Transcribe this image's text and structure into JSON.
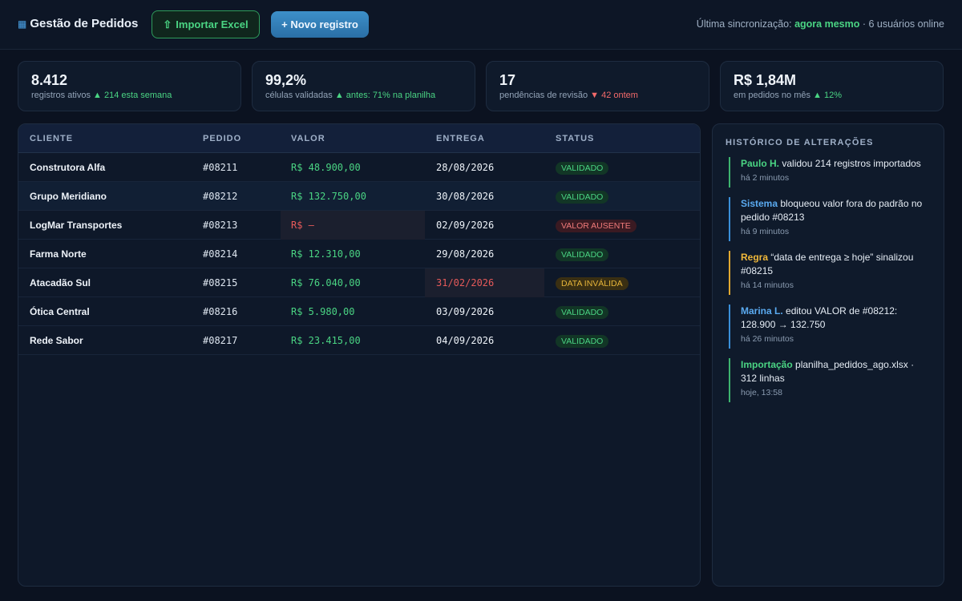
{
  "header": {
    "brand_icon": "▦",
    "title": "Gestão de Pedidos",
    "import_icon": "⇧",
    "import_label": "Importar Excel",
    "new_label": "+ Novo registro",
    "sync_prefix": "Última sincronização:",
    "sync_time": "agora mesmo",
    "sync_suffix": "· 6 usuários online"
  },
  "kpis": [
    {
      "value": "8.412",
      "label": "registros ativos",
      "trend_icon": "▲",
      "trend": "214 esta semana",
      "trend_dir": "up"
    },
    {
      "value": "99,2%",
      "label": "células validadas",
      "trend_icon": "▲",
      "trend": "antes: 71% na planilha",
      "trend_dir": "up"
    },
    {
      "value": "17",
      "label": "pendências de revisão",
      "trend_icon": "▼",
      "trend": "42 ontem",
      "trend_dir": "down"
    },
    {
      "value": "R$ 1,84M",
      "label": "em pedidos no mês",
      "trend_icon": "▲",
      "trend": "12%",
      "trend_dir": "up"
    }
  ],
  "table": {
    "columns": [
      "CLIENTE",
      "PEDIDO",
      "VALOR",
      "ENTREGA",
      "STATUS"
    ],
    "rows": [
      {
        "client": "Construtora Alfa",
        "order": "#08211",
        "value": "R$ 48.900,00",
        "date": "28/08/2026",
        "status": "VALIDADO"
      },
      {
        "client": "Grupo Meridiano",
        "order": "#08212",
        "value": "R$ 132.750,00",
        "date": "30/08/2026",
        "status": "VALIDADO"
      },
      {
        "client": "LogMar Transportes",
        "order": "#08213",
        "value": "R$ —",
        "date": "02/09/2026",
        "status": "VALOR AUSENTE"
      },
      {
        "client": "Farma Norte",
        "order": "#08214",
        "value": "R$ 12.310,00",
        "date": "29/08/2026",
        "status": "VALIDADO"
      },
      {
        "client": "Atacadão Sul",
        "order": "#08215",
        "value": "R$ 76.040,00",
        "date": "31/02/2026",
        "status": "DATA INVÁLIDA"
      },
      {
        "client": "Ótica Central",
        "order": "#08216",
        "value": "R$ 5.980,00",
        "date": "03/09/2026",
        "status": "VALIDADO"
      },
      {
        "client": "Rede Sabor",
        "order": "#08217",
        "value": "R$ 23.415,00",
        "date": "04/09/2026",
        "status": "VALIDADO"
      }
    ]
  },
  "history": {
    "title": "HISTÓRICO DE ALTERAÇÕES",
    "items": [
      {
        "actor": "Paulo H.",
        "text": "validou 214 registros importados",
        "time": "há 2 minutos",
        "color": "#3db36e"
      },
      {
        "actor": "Sistema",
        "text": "bloqueou valor fora do padrão no pedido #08213",
        "time": "há 9 minutos",
        "color": "#3a8fd8"
      },
      {
        "actor": "Regra",
        "text": "“data de entrega ≥ hoje” sinalizou #08215",
        "time": "há 14 minutos",
        "color": "#e0a830"
      },
      {
        "actor": "Marina L.",
        "text": "editou VALOR de #08212: 128.900 → 132.750",
        "time": "há 26 minutos",
        "color": "#3a8fd8"
      },
      {
        "actor": "Importação",
        "text": "planilha_pedidos_ago.xlsx · 312 linhas",
        "time": "hoje, 13:58",
        "color": "#3db36e"
      }
    ]
  }
}
